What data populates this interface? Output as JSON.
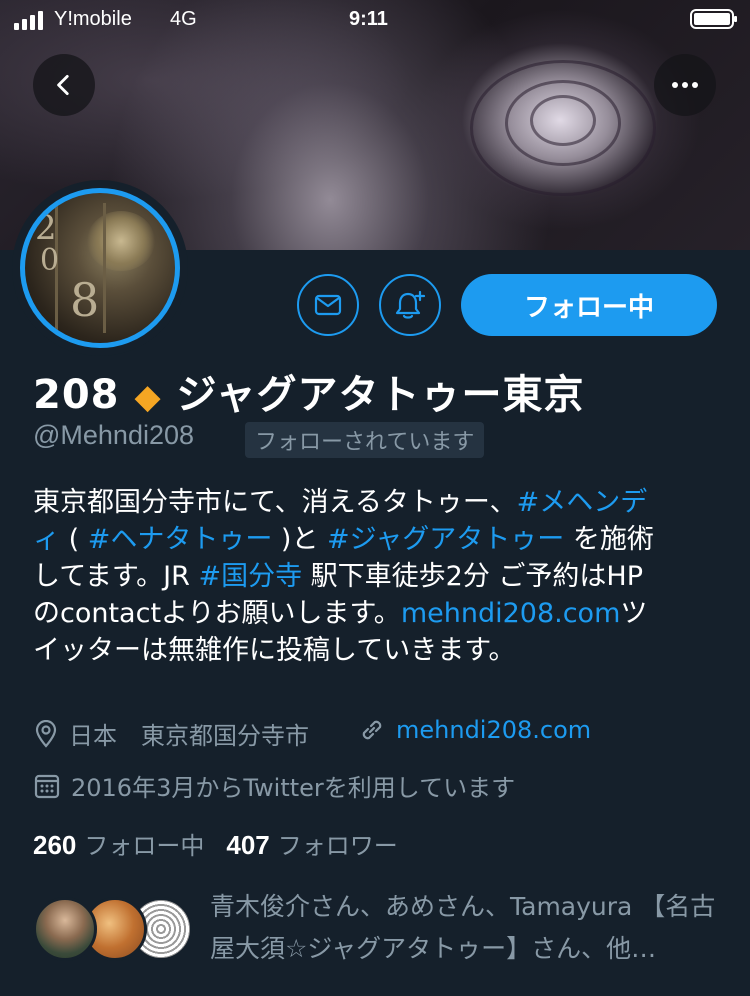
{
  "status_bar": {
    "carrier": "Y!mobile",
    "network": "4G",
    "time": "9:11"
  },
  "header": {
    "back_icon": "chevron-left-icon",
    "more_icon": "more-horizontal-icon"
  },
  "profile": {
    "display_name": "208",
    "name_emoji": "◆",
    "name_rest": "ジャグアタトゥー東京",
    "handle": "@Mehndi208",
    "follows_you": "フォローされています",
    "follow_button": "フォロー中",
    "bio": {
      "line1": "東京都国分寺市にて、消えるタトゥー、",
      "tag1a": "#メヘンデ",
      "tag1b": "ィ",
      "line2_paren_open": " ( ",
      "tag2": "#ヘナタトゥー",
      "line2_mid": " )と ",
      "tag3": "#ジャグアタトゥー",
      "line2_end": " を施術",
      "line3a": "してます。JR ",
      "tag4": "#国分寺",
      "line3b": " 駅下車徒歩2分 ご予約はHP",
      "line4a": "のcontactよりお願いします。",
      "link1": "mehndi208.com",
      "line4b": "ツ",
      "line5": "イッターは無雑作に投稿していきます。"
    },
    "location": "日本　東京都国分寺市",
    "website": "mehndi208.com",
    "joined": "2016年3月からTwitterを利用しています",
    "following_count": "260",
    "following_label": "フォロー中",
    "followers_count": "407",
    "followers_label": "フォロワー",
    "known_followers": "青木俊介さん、あめさん、Tamayura 【名古屋大須☆ジャグアタトゥー】さん、他…"
  },
  "colors": {
    "background": "#15202b",
    "accent": "#1d9bf0",
    "muted": "#8899a6",
    "emoji": "#f5a623"
  },
  "avatar_text": {
    "n1": "2",
    "n2": "0",
    "n3": "8"
  }
}
